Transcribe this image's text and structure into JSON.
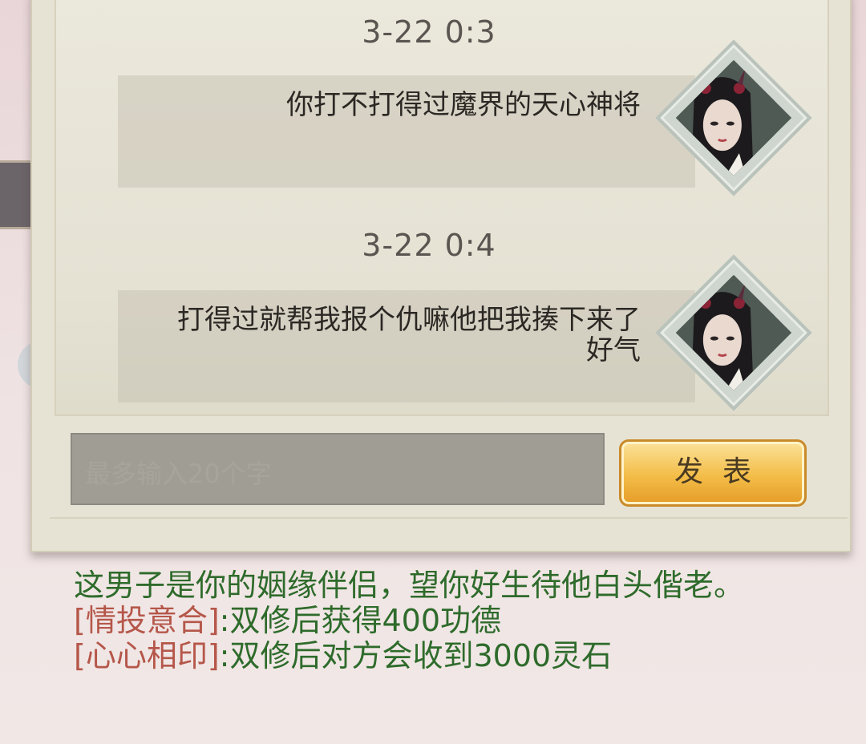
{
  "messages": [
    {
      "time": "3-22  0:3",
      "text": "你打不打得过魔界的天心神将"
    },
    {
      "time": "3-22  0:4",
      "text": "打得过就帮我报个仇嘛他把我揍下来了\n好气"
    }
  ],
  "input": {
    "placeholder": "最多输入20个字"
  },
  "send_label": "发表",
  "description": {
    "intro": "这男子是你的姻缘伴侣，望你好生待他白头偕老。",
    "perks": [
      {
        "tag": "[情投意合]",
        "text": ":双修后获得400功德"
      },
      {
        "tag": "[心心相印]",
        "text": ":双修后对方会收到3000灵石"
      }
    ]
  },
  "colors": {
    "green_text": "#2e6b2b",
    "tag_text": "#b5574a",
    "button": "#f3bd48"
  }
}
